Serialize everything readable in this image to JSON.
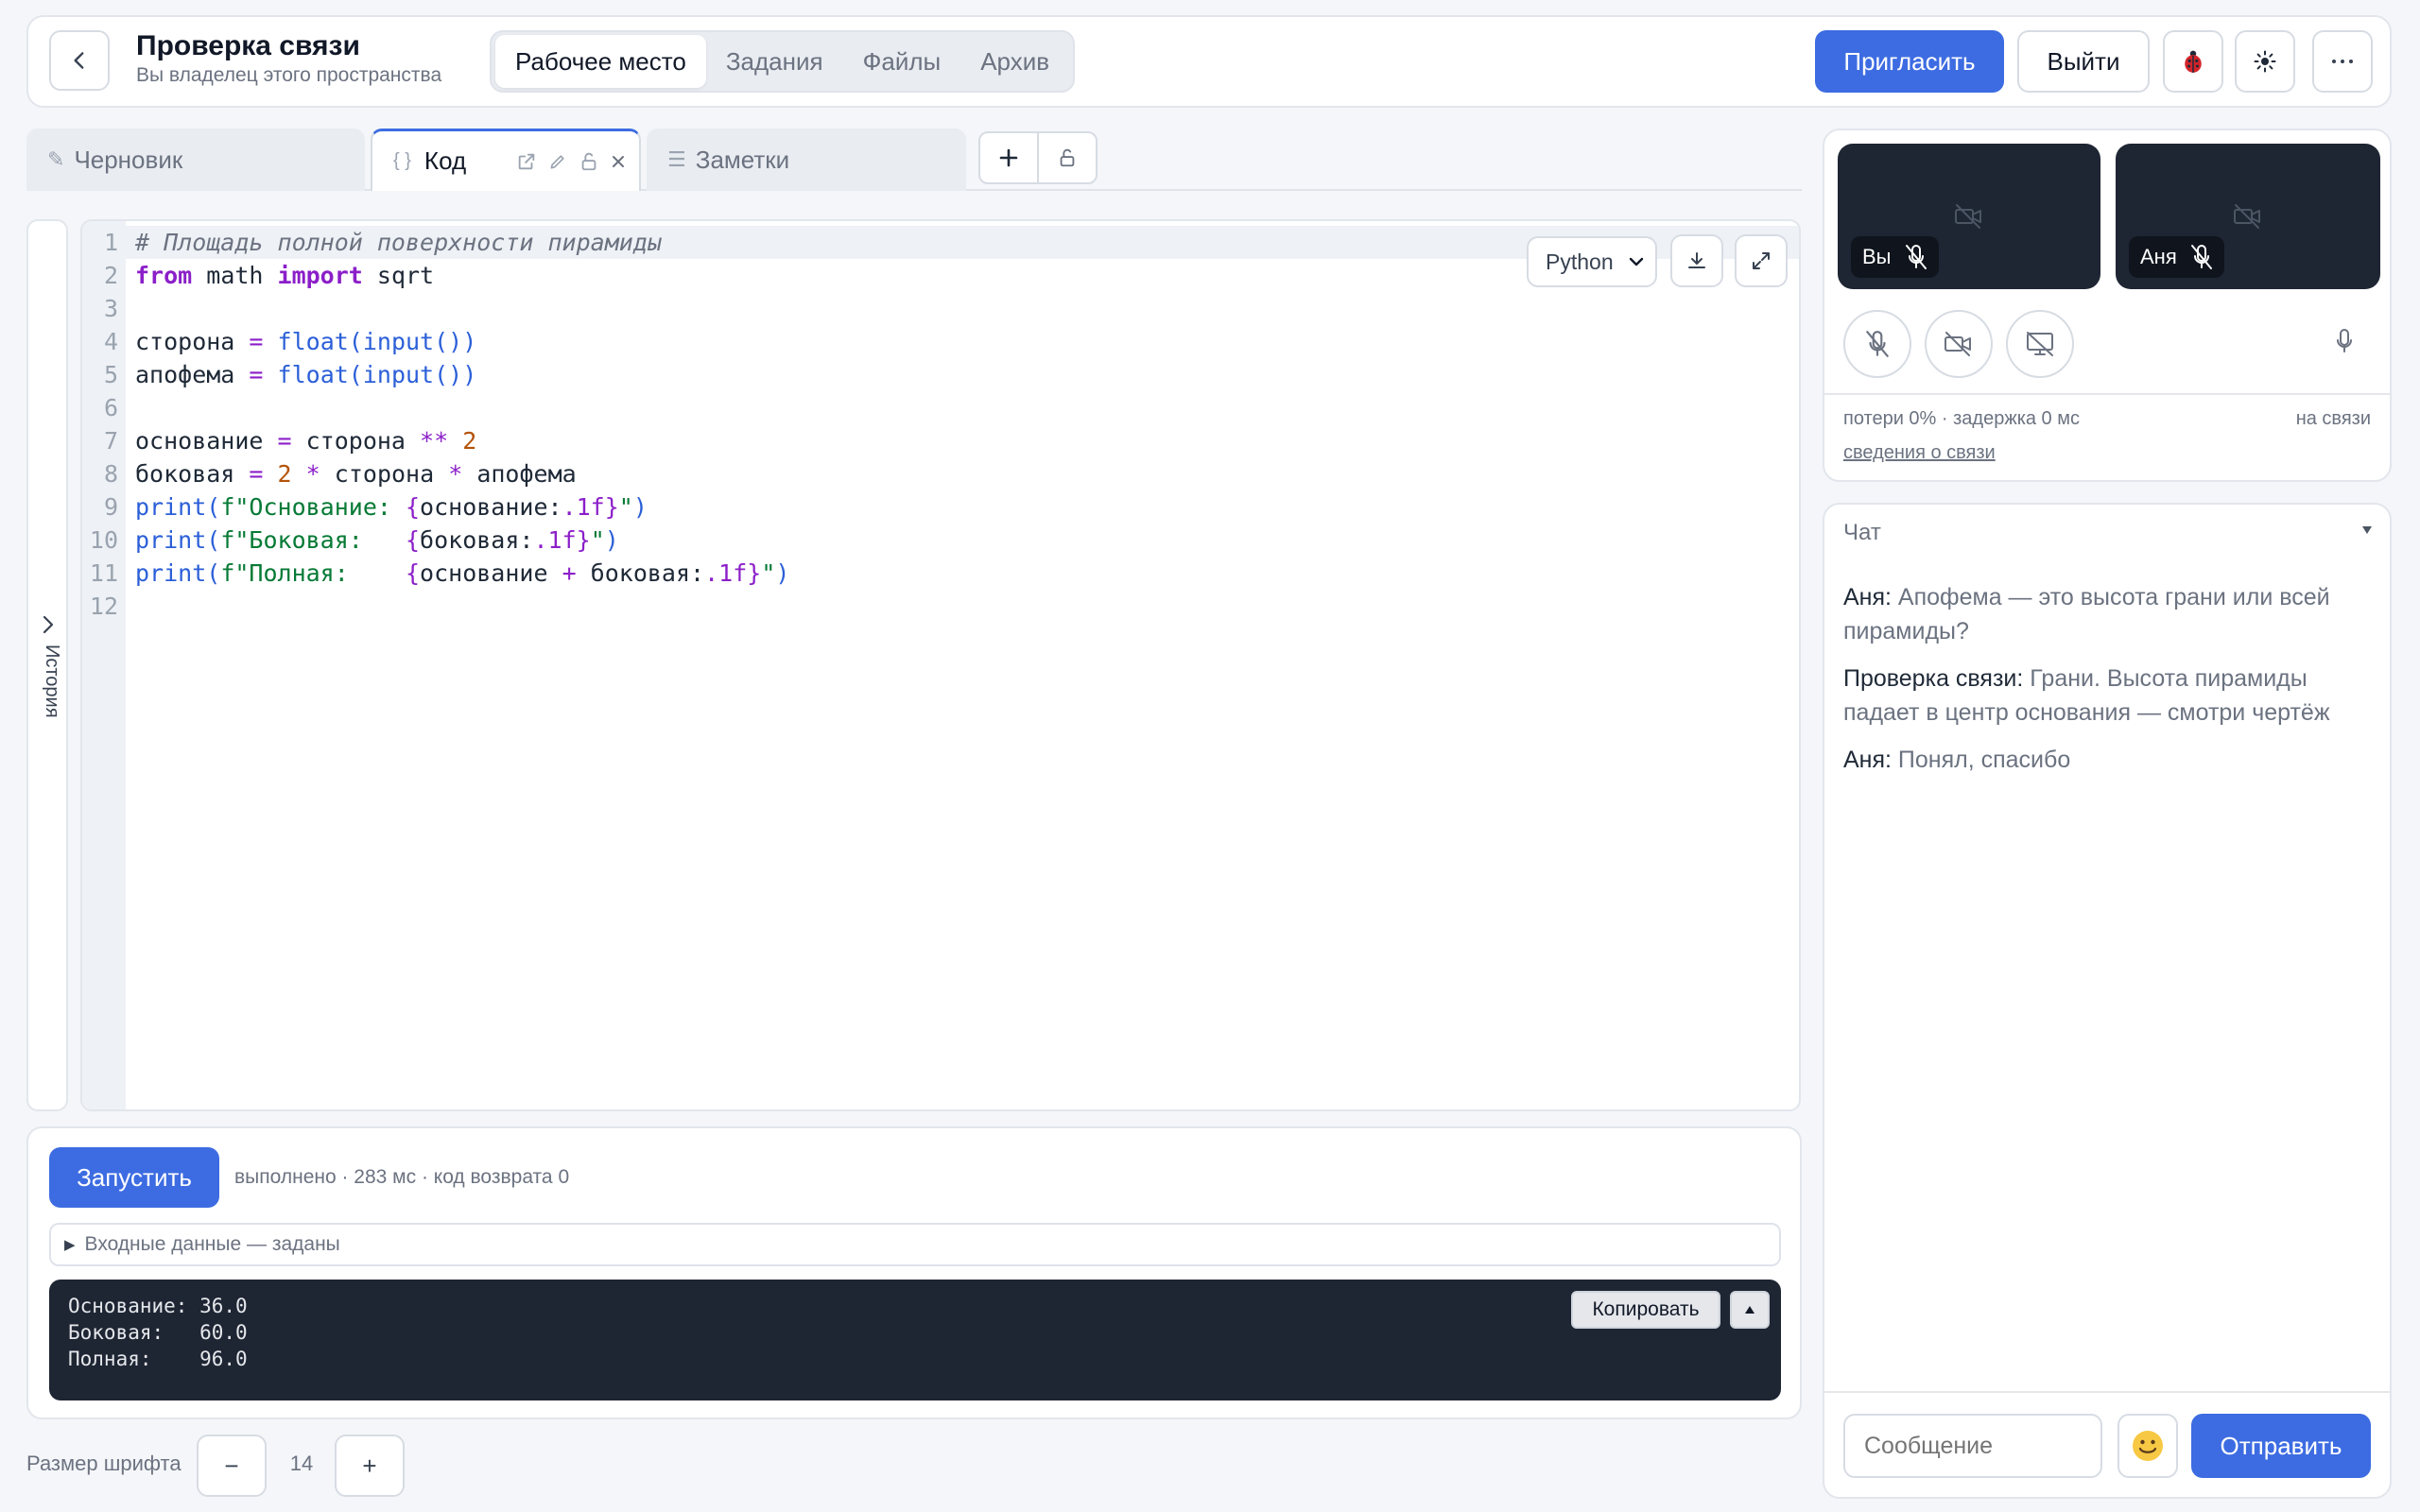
{
  "header": {
    "title": "Проверка связи",
    "subtitle": "Вы владелец этого пространства",
    "nav": [
      "Рабочее место",
      "Задания",
      "Файлы",
      "Архив"
    ],
    "invite_label": "Пригласить",
    "logout_label": "Выйти"
  },
  "tabs": [
    {
      "icon": "✎",
      "label": "Черновик"
    },
    {
      "icon": "{ }",
      "label": "Код"
    },
    {
      "icon": "☰",
      "label": "Заметки"
    }
  ],
  "sidebar": {
    "history_label": "История"
  },
  "editor": {
    "language": "Python",
    "languages": [
      "Python"
    ],
    "lines": [
      [
        [
          "tk-comment",
          "# Площадь полной поверхности пирамиды"
        ]
      ],
      [
        [
          "tk-kw",
          "from"
        ],
        [
          "",
          " math "
        ],
        [
          "tk-kw",
          "import"
        ],
        [
          "",
          " sqrt"
        ]
      ],
      [],
      [
        [
          "",
          "сторона "
        ],
        [
          "tk-op",
          "="
        ],
        [
          "",
          " "
        ],
        [
          "tk-fn",
          "float(input())"
        ]
      ],
      [
        [
          "",
          "апофема "
        ],
        [
          "tk-op",
          "="
        ],
        [
          "",
          " "
        ],
        [
          "tk-fn",
          "float(input())"
        ]
      ],
      [],
      [
        [
          "",
          "основание "
        ],
        [
          "tk-op",
          "="
        ],
        [
          "",
          " сторона "
        ],
        [
          "tk-op",
          "**"
        ],
        [
          "",
          " "
        ],
        [
          "tk-num",
          "2"
        ]
      ],
      [
        [
          "",
          "боковая "
        ],
        [
          "tk-op",
          "="
        ],
        [
          "",
          " "
        ],
        [
          "tk-num",
          "2"
        ],
        [
          "",
          " "
        ],
        [
          "tk-op",
          "*"
        ],
        [
          "",
          " сторона "
        ],
        [
          "tk-op",
          "*"
        ],
        [
          "",
          " апофема"
        ]
      ],
      [
        [
          "tk-fn",
          "print("
        ],
        [
          "tk-str",
          "f\"Основание: "
        ],
        [
          "tk-op",
          "{"
        ],
        [
          "",
          "основание:"
        ],
        [
          "tk-op",
          ".1f}"
        ],
        [
          "tk-str",
          "\""
        ],
        [
          "tk-fn",
          ")"
        ]
      ],
      [
        [
          "tk-fn",
          "print("
        ],
        [
          "tk-str",
          "f\"Боковая:   "
        ],
        [
          "tk-op",
          "{"
        ],
        [
          "",
          "боковая:"
        ],
        [
          "tk-op",
          ".1f}"
        ],
        [
          "tk-str",
          "\""
        ],
        [
          "tk-fn",
          ")"
        ]
      ],
      [
        [
          "tk-fn",
          "print("
        ],
        [
          "tk-str",
          "f\"Полная:    "
        ],
        [
          "tk-op",
          "{"
        ],
        [
          "",
          "основание "
        ],
        [
          "tk-op",
          "+"
        ],
        [
          "",
          " боковая:"
        ],
        [
          "tk-op",
          ".1f}"
        ],
        [
          "tk-str",
          "\""
        ],
        [
          "tk-fn",
          ")"
        ]
      ],
      []
    ]
  },
  "runner": {
    "run_label": "Запустить",
    "status": "выполнено · 283 мс · код возврата 0",
    "input_summary": "Входные данные — заданы",
    "copy_label": "Копировать",
    "output": [
      "Основание: 36.0",
      "Боковая:   60.0",
      "Полная:    96.0"
    ]
  },
  "font_size": {
    "label": "Размер шрифта",
    "value": "14",
    "minus": "−",
    "plus": "+"
  },
  "call": {
    "participants": [
      "Вы",
      "Аня"
    ],
    "stats": "потери 0% · задержка 0 мс",
    "status": "на связи",
    "details_link": "сведения о связи"
  },
  "chat": {
    "title": "Чат",
    "messages": [
      {
        "author": "Аня:",
        "text": "Апофема — это высота грани или всей пирамиды?"
      },
      {
        "author": "Проверка связи:",
        "text": "Грани. Высота пирамиды падает в центр основания — смотри чертёж"
      },
      {
        "author": "Аня:",
        "text": "Понял, спасибо"
      }
    ],
    "placeholder": "Сообщение",
    "send_label": "Отправить"
  },
  "colors": {
    "accent": "#3d6ce2",
    "dark_panel": "#1e2533"
  }
}
